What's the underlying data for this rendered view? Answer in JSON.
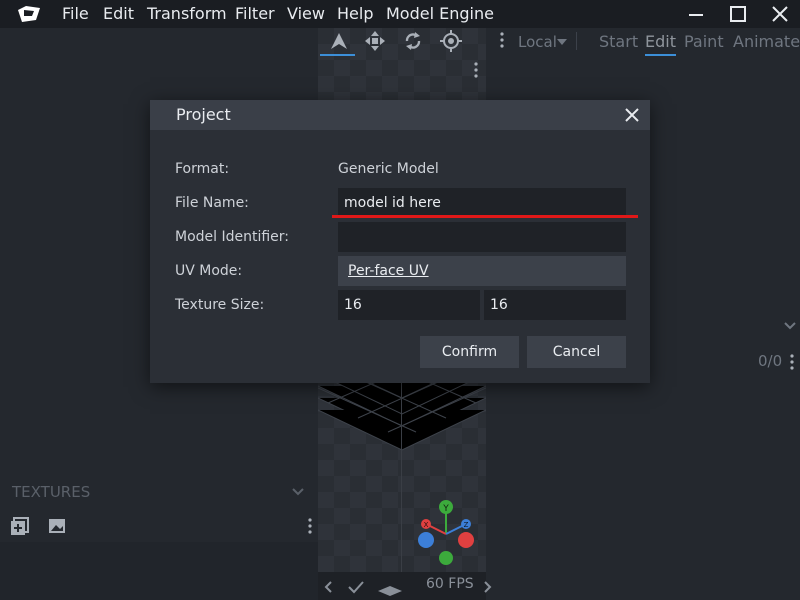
{
  "menubar": {
    "items": [
      "File",
      "Edit",
      "Transform",
      "Filter",
      "View",
      "Help",
      "Model Engine"
    ]
  },
  "toolbar": {
    "space_select": "Local",
    "modes": [
      "Start",
      "Edit",
      "Paint",
      "Animate"
    ],
    "active_mode": "Edit",
    "icons": [
      "move-tool-icon",
      "resize-tool-icon",
      "rotate-tool-icon",
      "pivot-tool-icon"
    ]
  },
  "left_panel": {
    "textures_title": "TEXTURES"
  },
  "right_panel": {
    "count": "0/0"
  },
  "viewport": {
    "fps": "60 FPS",
    "gizmo_axes": [
      "Y",
      "X",
      "Z"
    ]
  },
  "dialog": {
    "title": "Project",
    "format_label": "Format:",
    "format_value": "Generic Model",
    "file_name_label": "File Name:",
    "file_name_value": "model id here",
    "model_identifier_label": "Model Identifier:",
    "model_identifier_value": "",
    "uv_mode_label": "UV Mode:",
    "uv_mode_value": "Per-face UV",
    "texture_size_label": "Texture Size:",
    "texture_width": "16",
    "texture_height": "16",
    "confirm_label": "Confirm",
    "cancel_label": "Cancel"
  },
  "colors": {
    "accent_underline": "#3c8fd8",
    "annotation_red": "#e01818",
    "gizmo_red": "#e04040",
    "gizmo_green": "#3caa3c",
    "gizmo_blue": "#3c7fd8"
  }
}
